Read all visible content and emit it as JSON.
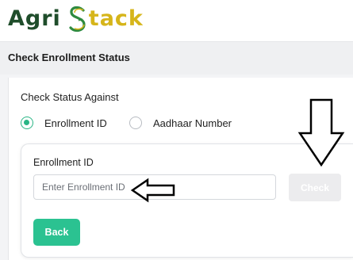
{
  "logo": {
    "part1": "Agri",
    "part2": "tack"
  },
  "page_title": "Check Enrollment Status",
  "status_section": {
    "label": "Check Status Against",
    "options": [
      {
        "label": "Enrollment ID",
        "selected": true
      },
      {
        "label": "Aadhaar Number",
        "selected": false
      }
    ]
  },
  "form": {
    "field_label": "Enrollment ID",
    "input_placeholder": "Enter Enrollment ID",
    "input_value": "",
    "check_label": "Check",
    "back_label": "Back"
  },
  "colors": {
    "accent_green": "#2bc291",
    "logo_dark_green": "#1f4d2b",
    "logo_yellow": "#d6b51a",
    "disabled_button": "#ececee"
  },
  "icons": {
    "logo_s": "sprouting-s-icon",
    "annotation_down": "arrow-down-icon",
    "annotation_left": "arrow-left-icon"
  }
}
